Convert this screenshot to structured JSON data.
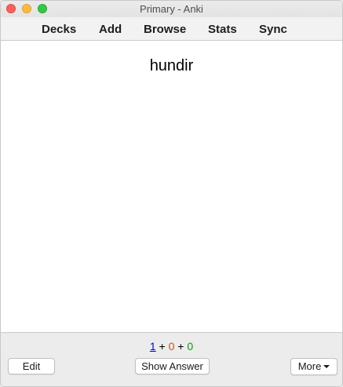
{
  "window": {
    "title": "Primary - Anki"
  },
  "toolbar": {
    "items": [
      {
        "label": "Decks"
      },
      {
        "label": "Add"
      },
      {
        "label": "Browse"
      },
      {
        "label": "Stats"
      },
      {
        "label": "Sync"
      }
    ]
  },
  "card": {
    "front_text": "hundir"
  },
  "counts": {
    "new": "1",
    "learning": "0",
    "review": "0",
    "separator": "+"
  },
  "buttons": {
    "edit_label": "Edit",
    "show_answer_label": "Show Answer",
    "more_label": "More"
  },
  "colors": {
    "new_count": "#0000ff",
    "learning_count": "#c35617",
    "review_count": "#00a000",
    "close_button": "#fc605c",
    "minimize_button": "#fdbc40",
    "maximize_button": "#34c84a"
  }
}
